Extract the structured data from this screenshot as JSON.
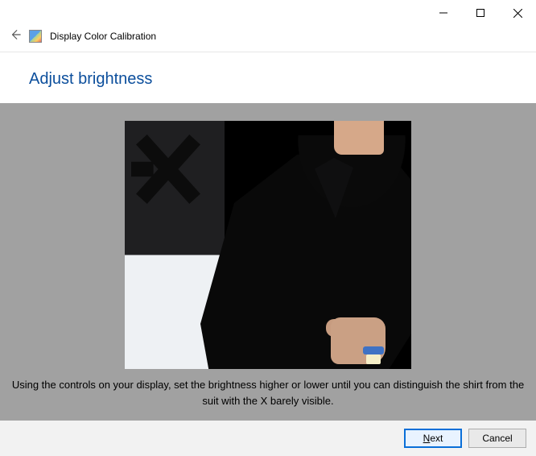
{
  "caption": {
    "tooltip_min": "Minimize",
    "tooltip_max": "Maximize",
    "tooltip_close": "Close"
  },
  "header": {
    "app_title": "Display Color Calibration"
  },
  "main": {
    "heading": "Adjust brightness",
    "instruction": "Using the controls on your display, set the brightness higher or lower until you can distinguish the shirt from the suit with the X barely visible."
  },
  "footer": {
    "next_mnemonic": "N",
    "next_rest": "ext",
    "cancel_label": "Cancel"
  }
}
